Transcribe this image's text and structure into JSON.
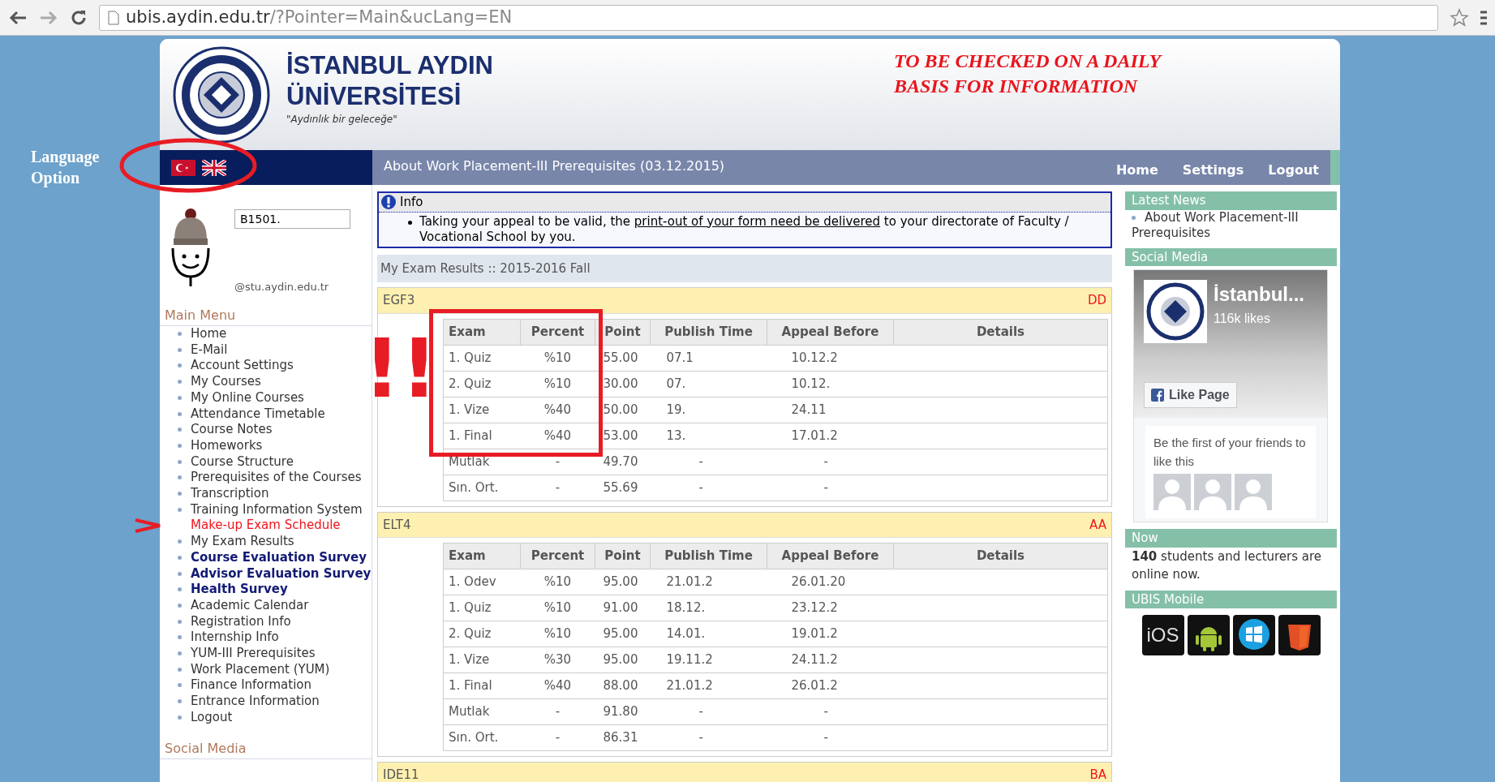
{
  "browser": {
    "url_host": "ubis.aydin.edu.tr",
    "url_path": "/?Pointer=Main&ucLang=EN"
  },
  "header": {
    "name_lines": [
      "İSTANBUL AYDIN",
      "ÜNİVERSİTESİ"
    ],
    "slogan": "\"Aydınlık bir geleceğe\"",
    "notice_lines": [
      "TO BE CHECKED ON A DAILY",
      "BASIS FOR INFORMATION"
    ]
  },
  "annotation": {
    "language_label_lines": [
      "Language",
      "Option"
    ],
    "exclamations": [
      "!",
      "!"
    ]
  },
  "nav": {
    "ticker": "About Work Placement-III Prerequisites (03.12.2015)",
    "links": [
      "Home",
      "Settings",
      "Logout"
    ]
  },
  "user": {
    "student_no": "B1501.",
    "email": "@stu.aydin.edu.tr"
  },
  "main_menu": {
    "title": "Main Menu",
    "items": [
      {
        "label": "Home",
        "kind": "normal"
      },
      {
        "label": "E-Mail",
        "kind": "normal"
      },
      {
        "label": "Account Settings",
        "kind": "normal"
      },
      {
        "label": "My Courses",
        "kind": "normal"
      },
      {
        "label": "My Online Courses",
        "kind": "normal"
      },
      {
        "label": "Attendance Timetable",
        "kind": "normal"
      },
      {
        "label": "Course Notes",
        "kind": "normal"
      },
      {
        "label": "Homeworks",
        "kind": "normal"
      },
      {
        "label": "Course Structure",
        "kind": "normal"
      },
      {
        "label": "Prerequisites of the Courses",
        "kind": "normal"
      },
      {
        "label": "Transcription",
        "kind": "normal"
      },
      {
        "label": "Training Information System",
        "kind": "normal"
      },
      {
        "label": "Make-up Exam Schedule",
        "kind": "alert"
      },
      {
        "label": "My Exam Results",
        "kind": "normal"
      },
      {
        "label": "Course Evaluation Survey",
        "kind": "bold"
      },
      {
        "label": "Advisor Evaluation Survey",
        "kind": "bold"
      },
      {
        "label": "Health Survey",
        "kind": "bold"
      },
      {
        "label": "Academic Calendar",
        "kind": "normal"
      },
      {
        "label": "Registration Info",
        "kind": "normal"
      },
      {
        "label": "Internship Info",
        "kind": "normal"
      },
      {
        "label": "YUM-III Prerequisites",
        "kind": "normal"
      },
      {
        "label": "Work Placement (YUM)",
        "kind": "normal"
      },
      {
        "label": "Finance Information",
        "kind": "normal"
      },
      {
        "label": "Entrance Information",
        "kind": "normal"
      },
      {
        "label": "Logout",
        "kind": "normal"
      }
    ],
    "next_title": "Social Media"
  },
  "info": {
    "title": "Info",
    "text_before": "Taking your appeal to be valid, the",
    "link": "print-out of your form need be delivered",
    "text_after": "to your directorate of Faculty / Vocational School by you."
  },
  "exam_results": {
    "title": "My Exam Results :: 2015-2016 Fall",
    "courses": [
      {
        "code": "EGF3",
        "grade": "DD",
        "annotated": true,
        "columns": [
          "Exam",
          "Percent",
          "Point",
          "Publish Time",
          "Appeal Before",
          "Details"
        ],
        "rows": [
          [
            "1. Quiz",
            "%10",
            "55.00",
            "07.1",
            "10.12.2",
            ""
          ],
          [
            "2. Quiz",
            "%10",
            "30.00",
            "07.",
            "10.12.",
            ""
          ],
          [
            "1. Vize",
            "%40",
            "50.00",
            "19.",
            "24.11",
            ""
          ],
          [
            "1. Final",
            "%40",
            "53.00",
            "13.",
            "17.01.2",
            ""
          ],
          [
            "Mutlak",
            "-",
            "49.70",
            "-",
            "-",
            ""
          ],
          [
            "Sın. Ort.",
            "-",
            "55.69",
            "-",
            "-",
            ""
          ]
        ]
      },
      {
        "code": "ELT4",
        "grade": "AA",
        "annotated": false,
        "columns": [
          "Exam",
          "Percent",
          "Point",
          "Publish Time",
          "Appeal Before",
          "Details"
        ],
        "rows": [
          [
            "1. Odev",
            "%10",
            "95.00",
            "21.01.2",
            "26.01.20",
            ""
          ],
          [
            "1. Quiz",
            "%10",
            "91.00",
            "18.12.",
            "23.12.2",
            ""
          ],
          [
            "2. Quiz",
            "%10",
            "95.00",
            "14.01.",
            "19.01.2",
            ""
          ],
          [
            "1. Vize",
            "%30",
            "95.00",
            "19.11.2",
            "24.11.2",
            ""
          ],
          [
            "1. Final",
            "%40",
            "88.00",
            "21.01.2",
            "26.01.2",
            ""
          ],
          [
            "Mutlak",
            "-",
            "91.80",
            "-",
            "-",
            ""
          ],
          [
            "Sın. Ort.",
            "-",
            "86.31",
            "-",
            "-",
            ""
          ]
        ]
      },
      {
        "code": "IDE11",
        "grade": "BA",
        "annotated": false
      }
    ]
  },
  "sidebar": {
    "latest_news": {
      "title": "Latest News",
      "items": [
        "About Work Placement-III Prerequisites"
      ]
    },
    "social_media": {
      "title": "Social Media",
      "page_name": "İstanbul...",
      "likes": "116k likes",
      "like_button": "Like Page",
      "friends_text": "Be the first of your friends to like this"
    },
    "now": {
      "title": "Now",
      "count": "140",
      "text": "students and lecturers are online now."
    },
    "mobile": {
      "title": "UBIS Mobile",
      "apps": [
        {
          "kind": "ios",
          "label": "iOS"
        },
        {
          "kind": "android"
        },
        {
          "kind": "windows"
        },
        {
          "kind": "html5"
        }
      ]
    }
  }
}
